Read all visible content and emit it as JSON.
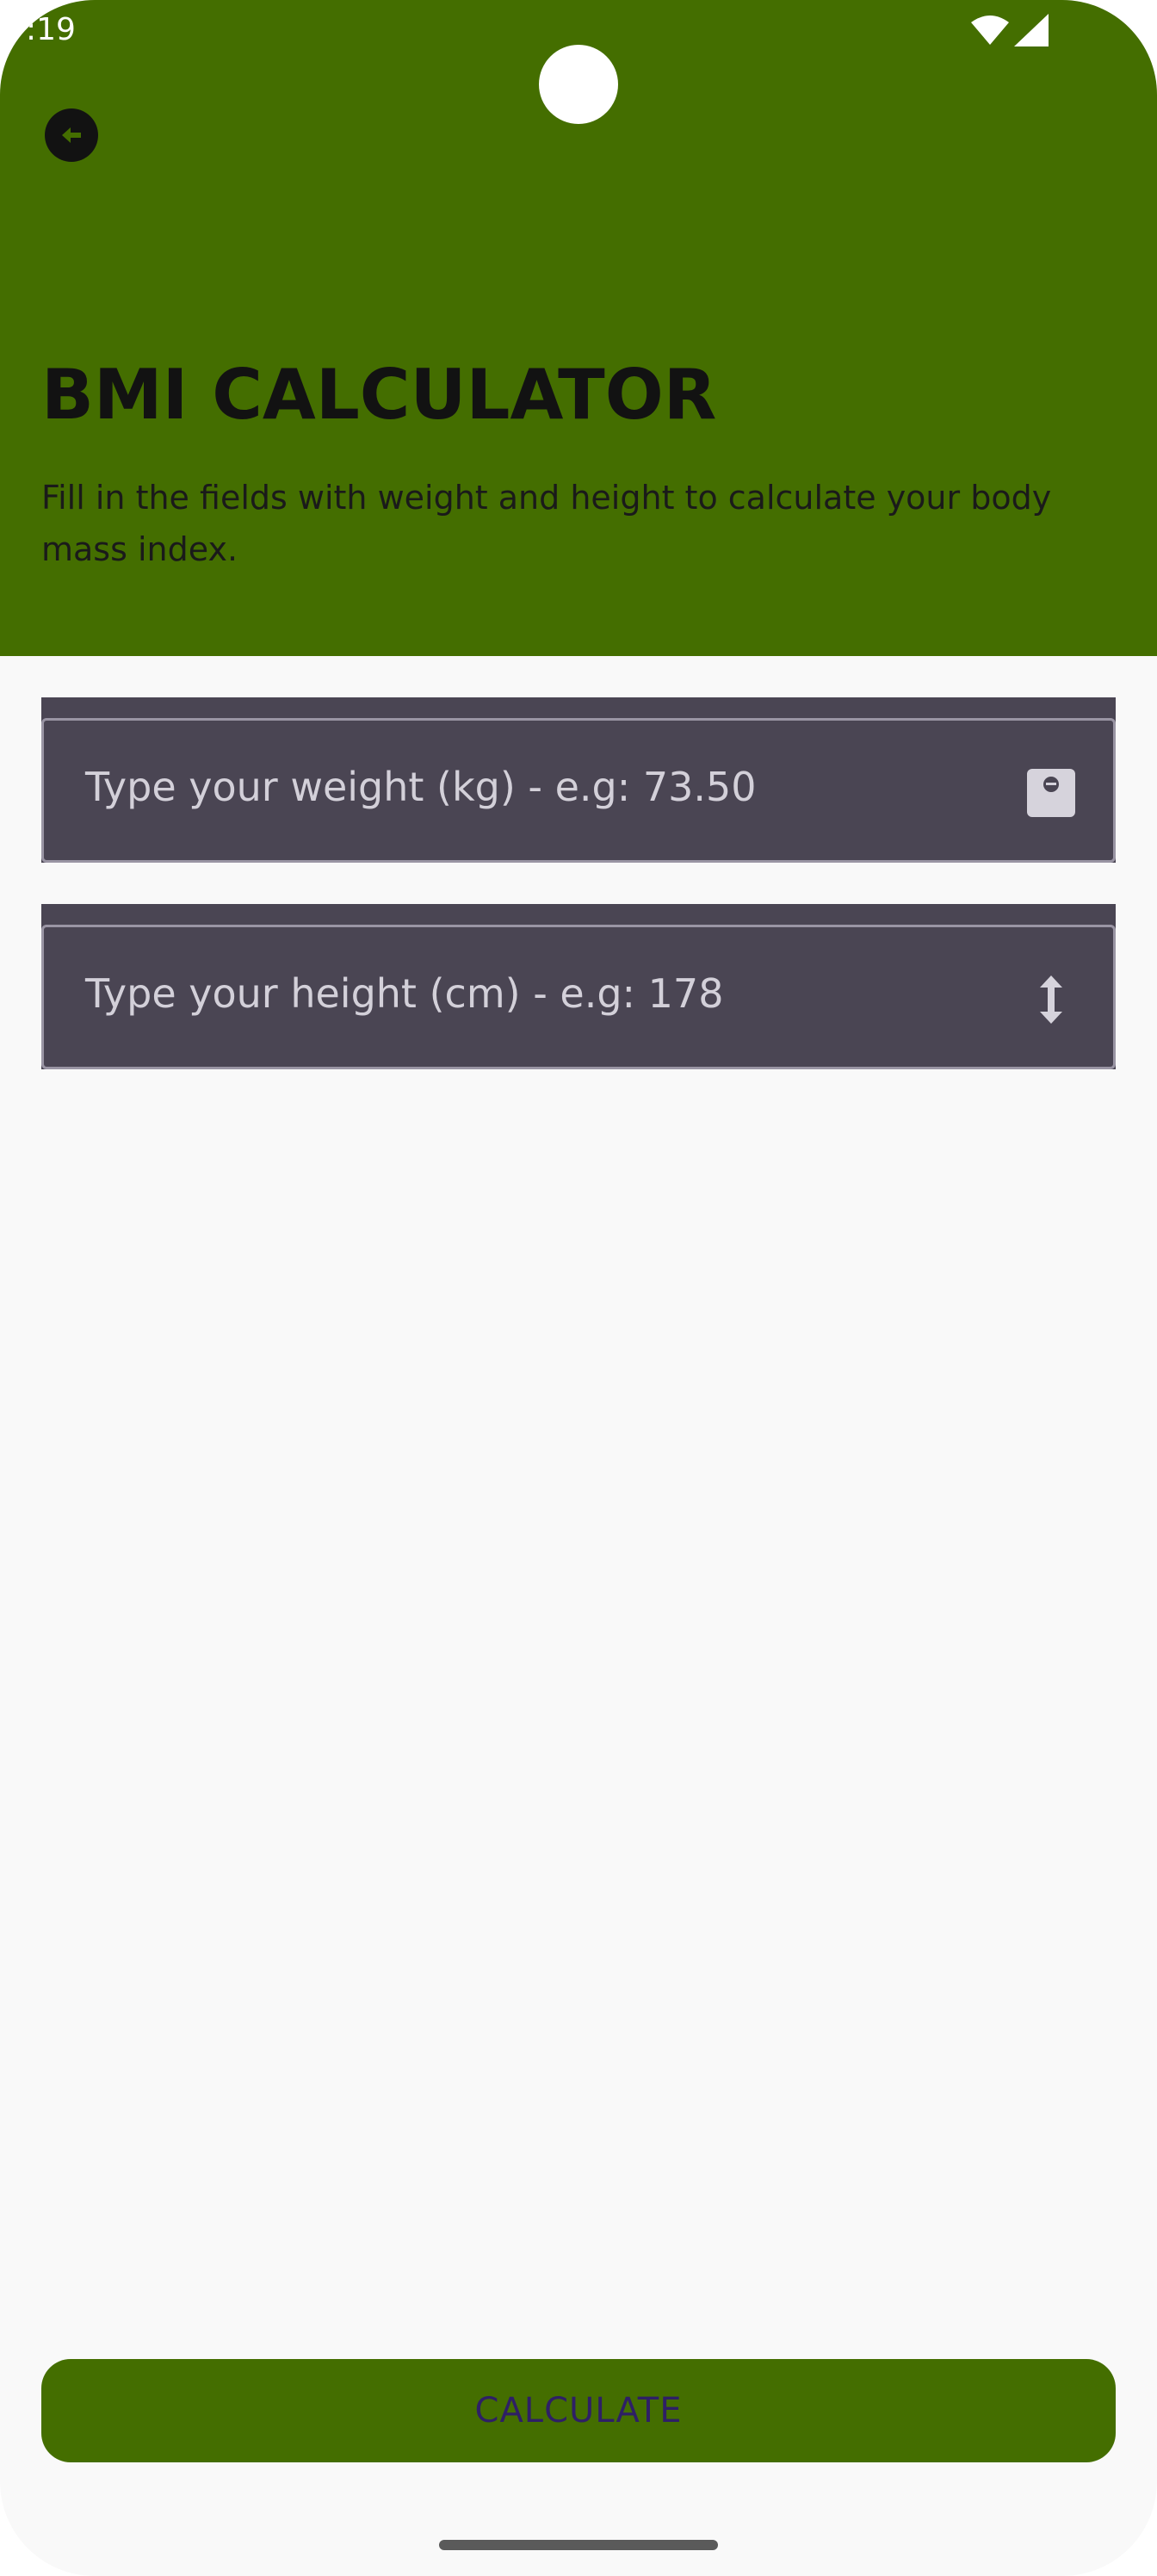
{
  "status_bar": {
    "time": ":19",
    "wifi_icon": "wifi-icon",
    "signal_icon": "signal-icon"
  },
  "header": {
    "back_icon": "back-arrow-icon",
    "title": "BMI CALCULATOR",
    "subtitle": "Fill in the fields with weight and height to calculate your body mass index."
  },
  "form": {
    "weight_placeholder": "Type your weight (kg) - e.g: 73.50",
    "weight_icon": "scale-icon",
    "height_placeholder": "Type your height (cm) - e.g: 178",
    "height_icon": "vertical-arrows-icon"
  },
  "actions": {
    "calculate_label": "CALCULATE"
  },
  "colors": {
    "header_green": "#446e00",
    "field_bg": "#4a4553",
    "button_text": "#2e1f66"
  }
}
